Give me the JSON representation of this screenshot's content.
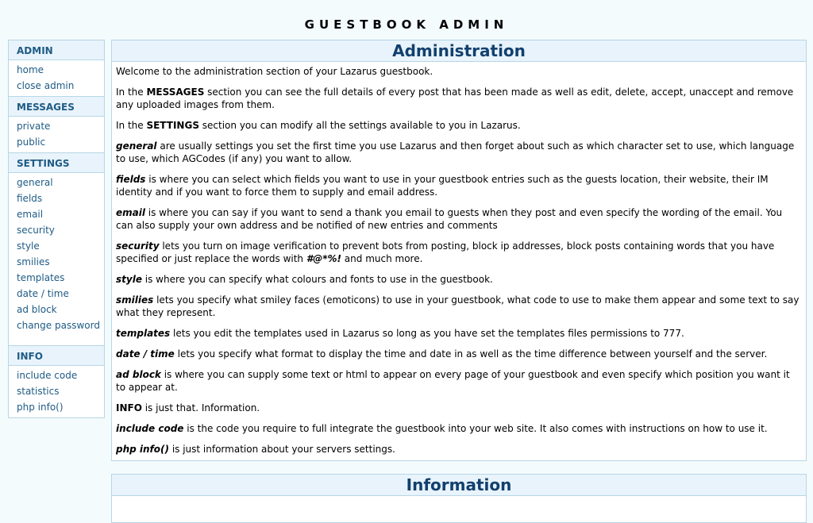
{
  "site": {
    "title": "GUESTBOOK ADMIN"
  },
  "sidebar": {
    "sections": [
      {
        "heading": "ADMIN",
        "items": [
          {
            "label": "home"
          },
          {
            "label": "close admin"
          }
        ]
      },
      {
        "heading": "MESSAGES",
        "items": [
          {
            "label": "private"
          },
          {
            "label": "public"
          }
        ]
      },
      {
        "heading": "SETTINGS",
        "items": [
          {
            "label": "general"
          },
          {
            "label": "fields"
          },
          {
            "label": "email"
          },
          {
            "label": "security"
          },
          {
            "label": "style"
          },
          {
            "label": "smilies"
          },
          {
            "label": "templates"
          },
          {
            "label": "date / time"
          },
          {
            "label": "ad block"
          },
          {
            "label": "change password"
          }
        ]
      },
      {
        "heading": "INFO",
        "items": [
          {
            "label": "include code"
          },
          {
            "label": "statistics"
          },
          {
            "label": "php info()"
          }
        ]
      }
    ]
  },
  "admin_panel": {
    "title": "Administration",
    "paragraphs": [
      {
        "lead": "",
        "text": "Welcome to the administration section of your Lazarus guestbook."
      },
      {
        "pre": "In the ",
        "bold": "MESSAGES",
        "text": " section you can see the full details of every post that has been made as well as edit, delete, accept, unaccept and remove any uploaded images from them."
      },
      {
        "pre": "In the ",
        "bold": "SETTINGS",
        "text": " section you can modify all the settings available to you in Lazarus."
      },
      {
        "lead": "general",
        "text": " are usually settings you set the first time you use Lazarus and then forget about such as which character set to use, which language to use, which AGCodes (if any) you want to allow."
      },
      {
        "lead": "fields",
        "text": " is where you can select which fields you want to use in your guestbook entries such as the guests location, their website, their IM identity and if you want to force them to supply and email address."
      },
      {
        "lead": "email",
        "text": " is where you can say if you want to send a thank you email to guests when they post and even specify the wording of the email. You can also supply your own address and be notified of new entries and comments"
      },
      {
        "lead": "security",
        "text": " lets you turn on image verification to prevent bots from posting, block ip addresses, block posts containing words that you have specified or just replace the words with ",
        "emph": "#@*%!",
        "tail": " and much more."
      },
      {
        "lead": "style",
        "text": " is where you can specify what colours and fonts to use in the guestbook."
      },
      {
        "lead": "smilies",
        "text": " lets you specify what smiley faces (emoticons) to use in your guestbook, what code to use to make them appear and some text to say what they represent."
      },
      {
        "lead": "templates",
        "text": " lets you edit the templates used in Lazarus so long as you have set the templates files permissions to 777."
      },
      {
        "lead": "date / time",
        "text": " lets you specify what format to display the time and date in as well as the time difference between yourself and the server."
      },
      {
        "lead": "ad block",
        "text": " is where you can supply some text or html to appear on every page of your guestbook and even specify which position you want it to appear at."
      },
      {
        "bold": "INFO",
        "text": " is just that. Information."
      },
      {
        "lead": "include code",
        "text": " is the code you require to full integrate the guestbook into your web site. It also comes with instructions on how to use it."
      },
      {
        "lead": "php info()",
        "text": " is just information about your servers settings."
      }
    ]
  },
  "info_panel": {
    "title": "Information"
  }
}
